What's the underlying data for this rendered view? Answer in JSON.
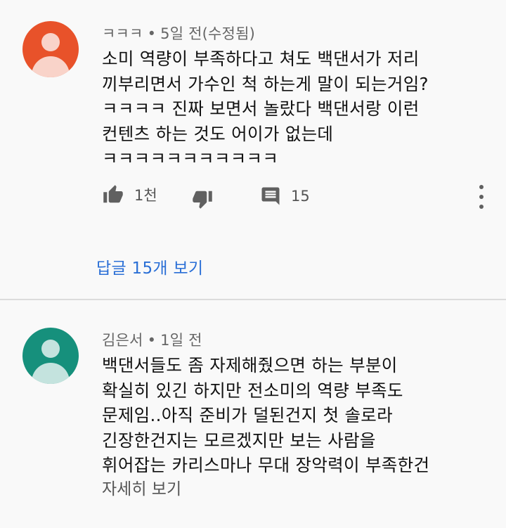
{
  "comments": [
    {
      "author": "ㅋㅋㅋ",
      "separator": "•",
      "time": "5일 전(수정됨)",
      "avatar_color": "#e8522a",
      "lines": [
        "소미 역량이 부족하다고 쳐도 백댄서가 저리",
        "끼부리면서 가수인 척 하는게 말이 되는거임?",
        "ㅋㅋㅋㅋ 진짜 보면서 놀랐다 백댄서랑 이런",
        "컨텐츠 하는 것도 어이가 없는데",
        "ㅋㅋㅋㅋㅋㅋㅋㅋㅋㅋㅋ"
      ],
      "likes": "1천",
      "reply_count": "15",
      "replies_link": "답글 15개 보기"
    },
    {
      "author": "김은서",
      "separator": "•",
      "time": "1일 전",
      "avatar_color": "#16907c",
      "lines": [
        "백댄서들도 좀 자제해줬으면 하는 부분이",
        "확실히 있긴 하지만 전소미의 역량 부족도",
        "문제임..아직 준비가 덜된건지 첫 솔로라",
        "긴장한건지는 모르겠지만 보는 사람을",
        "휘어잡는 카리스마나 무대 장악력이 부족한건"
      ],
      "read_more": "자세히 보기"
    }
  ],
  "colors": {
    "background": "#f9f9f9",
    "link_blue": "#2a6fd6",
    "meta_gray": "#666666"
  },
  "icons": [
    "like-icon",
    "dislike-icon",
    "reply-icon",
    "more-vert-icon"
  ]
}
